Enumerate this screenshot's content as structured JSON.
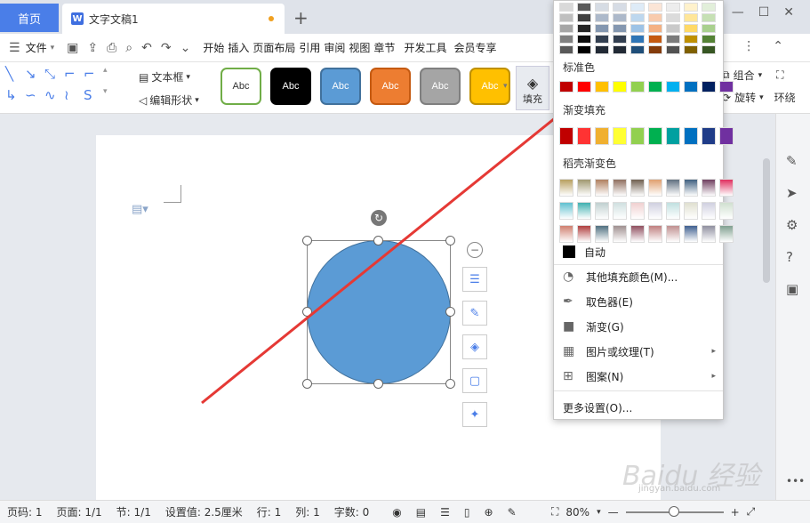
{
  "tabs": {
    "home": "首页",
    "doc": "文字文稿1",
    "doc_icon": "W"
  },
  "menubar": {
    "file": "文件",
    "items": [
      "开始",
      "插入",
      "页面布局",
      "引用",
      "审阅",
      "视图",
      "章节",
      "开发工具",
      "会员专享"
    ]
  },
  "ribbon": {
    "textbox": "文本框",
    "edit_shape": "编辑形状",
    "style_label": "Abc",
    "styles": [
      {
        "bg": "#ffffff",
        "border": "#70ad47",
        "color": "#333333"
      },
      {
        "bg": "#000000",
        "border": "#000000",
        "color": "#ffffff"
      },
      {
        "bg": "#5b9bd5",
        "border": "#41719c",
        "color": "#ffffff"
      },
      {
        "bg": "#ed7d31",
        "border": "#c55a11",
        "color": "#ffffff"
      },
      {
        "bg": "#a5a5a5",
        "border": "#7f7f7f",
        "color": "#ffffff"
      },
      {
        "bg": "#ffc000",
        "border": "#bf9000",
        "color": "#ffffff"
      }
    ],
    "fill": "填充",
    "group": "组合",
    "rotate": "旋转",
    "wrap": "环绕"
  },
  "dropdown": {
    "standard_colors_title": "标准色",
    "gradient_fill_title": "渐变填充",
    "shell_gradient_title": "稻壳渐变色",
    "auto": "自动",
    "more_fill_colors": "其他填充颜色(M)...",
    "eyedropper": "取色器(E)",
    "gradient": "渐变(G)",
    "picture_texture": "图片或纹理(T)",
    "pattern": "图案(N)",
    "more_settings": "更多设置(O)...",
    "theme_rows": [
      [
        "#d9d9d9",
        "#595959",
        "#d6dce4",
        "#d6dce5",
        "#deebf7",
        "#fbe5d6",
        "#ededed",
        "#fff2cc",
        "#e2efda"
      ],
      [
        "#bfbfbf",
        "#404040",
        "#adb9ca",
        "#adb9ca",
        "#bdd7ee",
        "#f8cbad",
        "#dbdbdb",
        "#ffe699",
        "#c6e0b4"
      ],
      [
        "#a6a6a6",
        "#262626",
        "#8497b0",
        "#8497b0",
        "#9dc3e6",
        "#f4b183",
        "#c9c9c9",
        "#ffd966",
        "#a9d08e"
      ],
      [
        "#808080",
        "#0d0d0d",
        "#333f50",
        "#333f50",
        "#2e75b6",
        "#c55a11",
        "#7b7b7b",
        "#bf9000",
        "#548235"
      ],
      [
        "#595959",
        "#000000",
        "#222a35",
        "#222a35",
        "#1f4e79",
        "#843c0c",
        "#525252",
        "#7f6000",
        "#375623"
      ]
    ],
    "standard_colors": [
      "#c00000",
      "#ff0000",
      "#ffc000",
      "#ffff00",
      "#92d050",
      "#00b050",
      "#00b0f0",
      "#0070c0",
      "#002060",
      "#7030a0"
    ],
    "gradient_colors": [
      "#c00000",
      "#ff3333",
      "#f0b030",
      "#ffff33",
      "#92d050",
      "#00b050",
      "#00a0a0",
      "#0070c0",
      "#1f3c88",
      "#7030a0"
    ],
    "shell_rows": [
      [
        "#b8a060",
        "#a09870",
        "#b08060",
        "#907060",
        "#706050",
        "#e0a070",
        "#607080",
        "#406080",
        "#704060",
        "#e03060"
      ],
      [
        "#60c0d0",
        "#40b0b0",
        "#c0d0d0",
        "#d0e0e0",
        "#f0d0d0",
        "#d0d0e0",
        "#c0e0e0",
        "#e0e0d0",
        "#d0d0e0",
        "#d0e0d0"
      ],
      [
        "#d08070",
        "#b04040",
        "#507080",
        "#a09090",
        "#905060",
        "#c08080",
        "#c09090",
        "#406090",
        "#9090a0",
        "#80a090"
      ]
    ]
  },
  "status": {
    "page_num": "页码: 1",
    "pages": "页面: 1/1",
    "section": "节: 1/1",
    "setting": "设置值: 2.5厘米",
    "row": "行: 1",
    "col": "列: 1",
    "words": "字数: 0",
    "zoom": "80%"
  },
  "watermark": {
    "brand": "Baidu 经验",
    "url": "jingyan.baidu.com"
  }
}
